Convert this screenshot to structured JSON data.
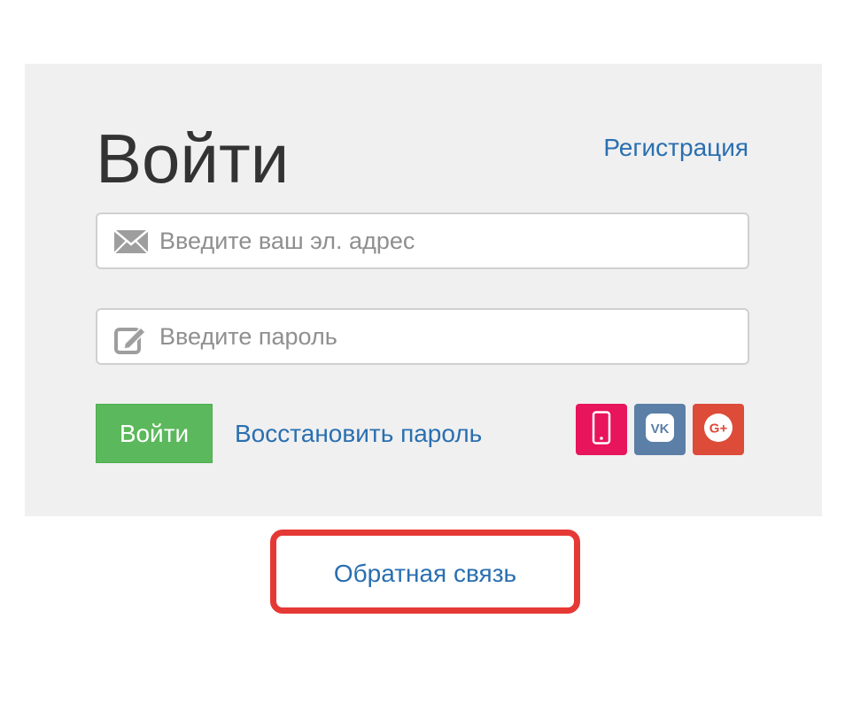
{
  "login": {
    "title": "Войти",
    "register_link": "Регистрация",
    "email_placeholder": "Введите ваш эл. адрес",
    "password_placeholder": "Введите пароль",
    "submit_label": "Войти",
    "restore_link": "Восстановить пароль",
    "social": [
      {
        "name": "phone-icon",
        "color": "#e8145c"
      },
      {
        "name": "vk-icon",
        "color": "#5b7fa6",
        "text": "VK"
      },
      {
        "name": "google-plus-icon",
        "color": "#dd4b39",
        "text": "G+"
      }
    ]
  },
  "feedback": {
    "label": "Обратная связь",
    "highlight_color": "#e53935"
  },
  "colors": {
    "link": "#2a6fb0",
    "button": "#5cb85c",
    "panel": "#f0f0f0"
  }
}
